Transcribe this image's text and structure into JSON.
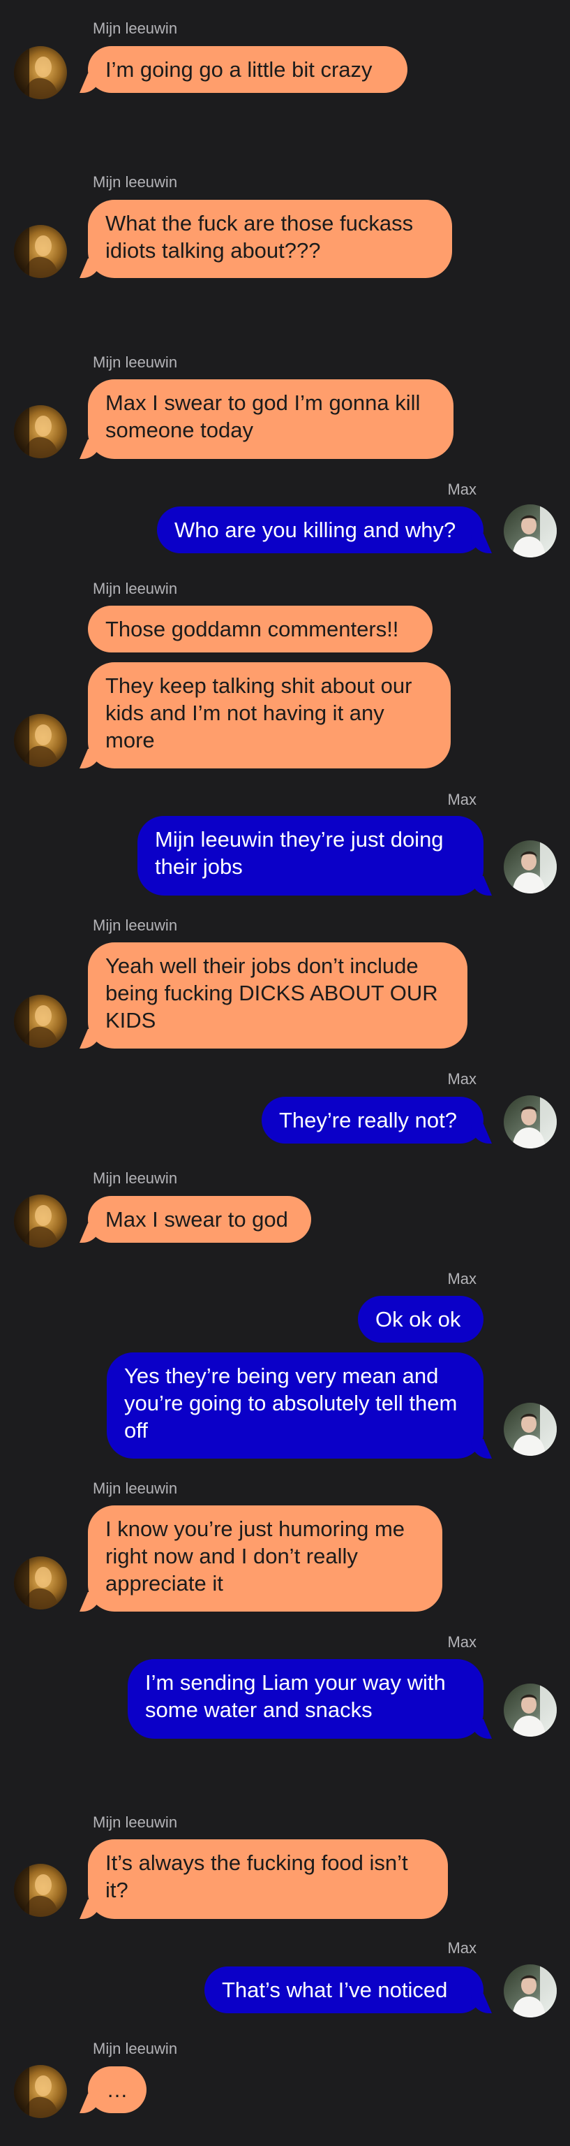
{
  "conversation": {
    "participants": {
      "left_name": "Mijn leeuwin",
      "right_name": "Max"
    },
    "messages": [
      {
        "from": "Mijn leeuwin",
        "text": "I’m going go a little bit crazy"
      },
      {
        "from": "Mijn leeuwin",
        "text": "What the fuck are those fuckass idiots talking about???"
      },
      {
        "from": "Mijn leeuwin",
        "text": "Max I swear to god I’m gonna kill someone today"
      },
      {
        "from": "Max",
        "text": "Who are you killing and why?"
      },
      {
        "from": "Mijn leeuwin",
        "text": "Those goddamn commenters!!"
      },
      {
        "from": "Mijn leeuwin",
        "text": "They keep talking shit about our kids and I’m not having it any more"
      },
      {
        "from": "Max",
        "text": "Mijn leeuwin they’re just doing their jobs"
      },
      {
        "from": "Mijn leeuwin",
        "text": "Yeah well their jobs don’t include being fucking DICKS ABOUT OUR KIDS"
      },
      {
        "from": "Max",
        "text": "They’re really not?"
      },
      {
        "from": "Mijn leeuwin",
        "text": "Max I swear to god"
      },
      {
        "from": "Max",
        "text": "Ok ok ok"
      },
      {
        "from": "Max",
        "text": "Yes they’re being very mean and you’re going to absolutely tell them off"
      },
      {
        "from": "Mijn leeuwin",
        "text": "I know you’re just humoring me right now and I don’t really appreciate it"
      },
      {
        "from": "Max",
        "text": "I’m sending Liam your way with some water and snacks"
      },
      {
        "from": "Mijn leeuwin",
        "text": "It’s always the fucking food isn’t it?"
      },
      {
        "from": "Max",
        "text": "That’s what I’ve noticed"
      },
      {
        "from": "Mijn leeuwin",
        "text": "…"
      }
    ]
  },
  "colors": {
    "background": "#1c1c1e",
    "incoming_bubble": "#ff9e6c",
    "outgoing_bubble": "#0b00c8",
    "sender_label": "#b4b4b8"
  },
  "icons": {
    "left_avatar": "avatar-photo-icon",
    "right_avatar": "avatar-photo-icon"
  }
}
